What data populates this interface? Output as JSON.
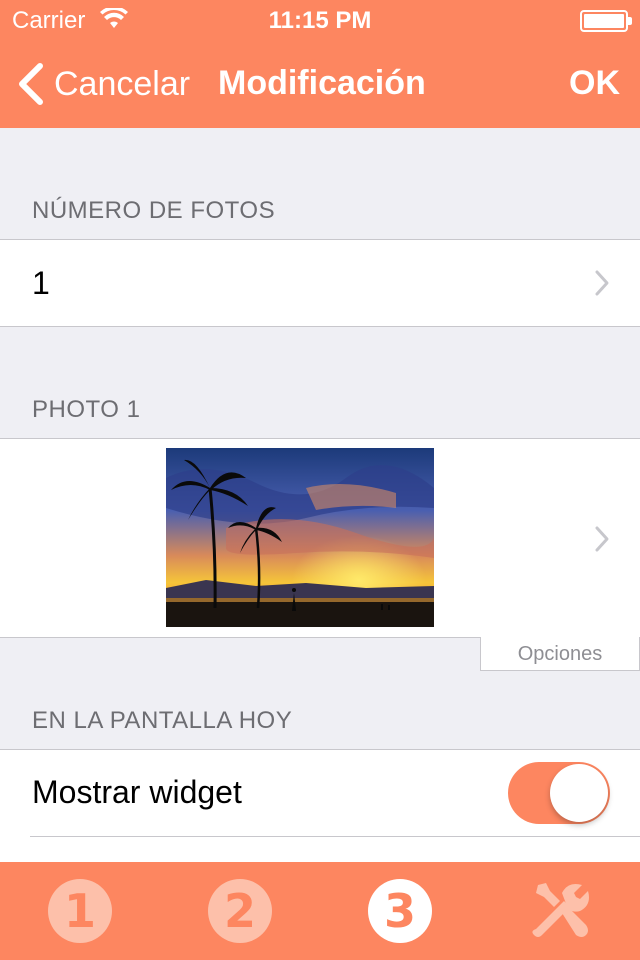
{
  "status_bar": {
    "carrier": "Carrier",
    "time": "11:15 PM",
    "battery_level": 1.0
  },
  "nav": {
    "back_label": "Cancelar",
    "title": "Modificación",
    "ok_label": "OK"
  },
  "sections": {
    "photos_count": {
      "header": "NÚMERO DE FOTOS",
      "value": "1"
    },
    "photo1": {
      "header": "PHOTO 1",
      "image_description": "tropical-sunset-palm-trees",
      "options_label": "Opciones"
    },
    "today_screen": {
      "header": "EN LA PANTALLA HOY",
      "widget_label": "Mostrar widget",
      "widget_enabled": true
    }
  },
  "tabbar": {
    "tabs": [
      {
        "label": "1",
        "active": false
      },
      {
        "label": "2",
        "active": false
      },
      {
        "label": "3",
        "active": true
      },
      {
        "icon": "tools-icon",
        "active": false
      }
    ]
  },
  "colors": {
    "accent": "#fd8660",
    "background": "#efeff4",
    "tab_inactive": "#fdc0aa"
  }
}
